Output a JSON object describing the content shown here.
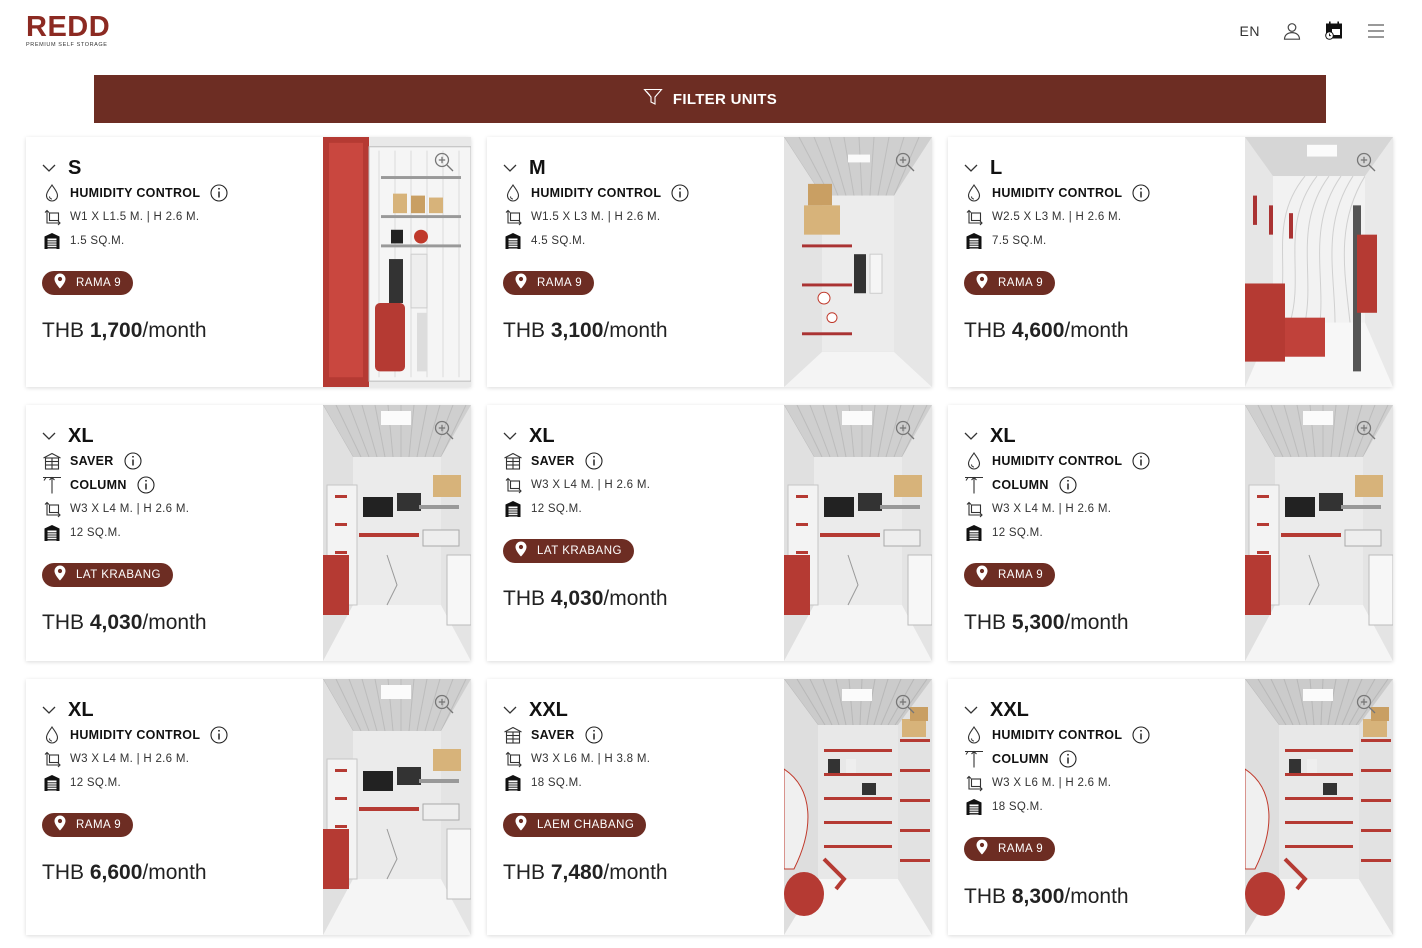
{
  "brand": {
    "name": "REDD",
    "tagline": "PREMIUM SELF STORAGE"
  },
  "header": {
    "language": "EN",
    "icons": [
      "user-icon",
      "calendar-icon",
      "menu-icon"
    ]
  },
  "filter": {
    "label": "FILTER UNITS"
  },
  "colors": {
    "brand": "#6d2d23",
    "logo": "#8c2a22"
  },
  "price_prefix": "THB ",
  "price_suffix": "/month",
  "cards": [
    {
      "size": "S",
      "features": [
        {
          "icon": "droplet-icon",
          "label": "HUMIDITY CONTROL",
          "info": true
        }
      ],
      "dims": "W1 X L1.5 M. | H 2.6 M.",
      "area": "1.5 SQ.M.",
      "location": "RAMA 9",
      "price": "1,700",
      "image": "locker-closet"
    },
    {
      "size": "M",
      "features": [
        {
          "icon": "droplet-icon",
          "label": "HUMIDITY CONTROL",
          "info": true
        }
      ],
      "dims": "W1.5 X L3 M. | H 2.6 M.",
      "area": "4.5 SQ.M.",
      "location": "RAMA 9",
      "price": "3,100",
      "image": "narrow-room"
    },
    {
      "size": "L",
      "features": [
        {
          "icon": "droplet-icon",
          "label": "HUMIDITY CONTROL",
          "info": true
        }
      ],
      "dims": "W2.5 X L3 M. | H 2.6 M.",
      "area": "7.5 SQ.M.",
      "location": "RAMA 9",
      "price": "4,600",
      "image": "sofa-room"
    },
    {
      "size": "XL",
      "features": [
        {
          "icon": "saver-icon",
          "label": "SAVER",
          "info": true
        },
        {
          "icon": "column-icon",
          "label": "COLUMN",
          "info": true
        }
      ],
      "dims": "W3 X L4 M. | H 2.6 M.",
      "area": "12 SQ.M.",
      "location": "LAT KRABANG",
      "price": "4,030",
      "image": "office-room"
    },
    {
      "size": "XL",
      "features": [
        {
          "icon": "saver-icon",
          "label": "SAVER",
          "info": true
        }
      ],
      "dims": "W3 X L4 M. | H 2.6 M.",
      "area": "12 SQ.M.",
      "location": "LAT KRABANG",
      "price": "4,030",
      "image": "office-room"
    },
    {
      "size": "XL",
      "features": [
        {
          "icon": "droplet-icon",
          "label": "HUMIDITY CONTROL",
          "info": true
        },
        {
          "icon": "column-icon",
          "label": "COLUMN",
          "info": true
        }
      ],
      "dims": "W3 X L4 M. | H 2.6 M.",
      "area": "12 SQ.M.",
      "location": "RAMA 9",
      "price": "5,300",
      "image": "office-room"
    },
    {
      "size": "XL",
      "features": [
        {
          "icon": "droplet-icon",
          "label": "HUMIDITY CONTROL",
          "info": true
        }
      ],
      "dims": "W3 X L4 M. | H 2.6 M.",
      "area": "12 SQ.M.",
      "location": "RAMA 9",
      "price": "6,600",
      "image": "office-room"
    },
    {
      "size": "XXL",
      "features": [
        {
          "icon": "saver-icon",
          "label": "SAVER",
          "info": true
        }
      ],
      "dims": "W3 X L6 M. | H 3.8 M.",
      "area": "18 SQ.M.",
      "location": "LAEM CHABANG",
      "price": "7,480",
      "image": "warehouse-room"
    },
    {
      "size": "XXL",
      "features": [
        {
          "icon": "droplet-icon",
          "label": "HUMIDITY CONTROL",
          "info": true
        },
        {
          "icon": "column-icon",
          "label": "COLUMN",
          "info": true
        }
      ],
      "dims": "W3 X L6 M. | H 2.6 M.",
      "area": "18 SQ.M.",
      "location": "RAMA 9",
      "price": "8,300",
      "image": "warehouse-room"
    }
  ]
}
